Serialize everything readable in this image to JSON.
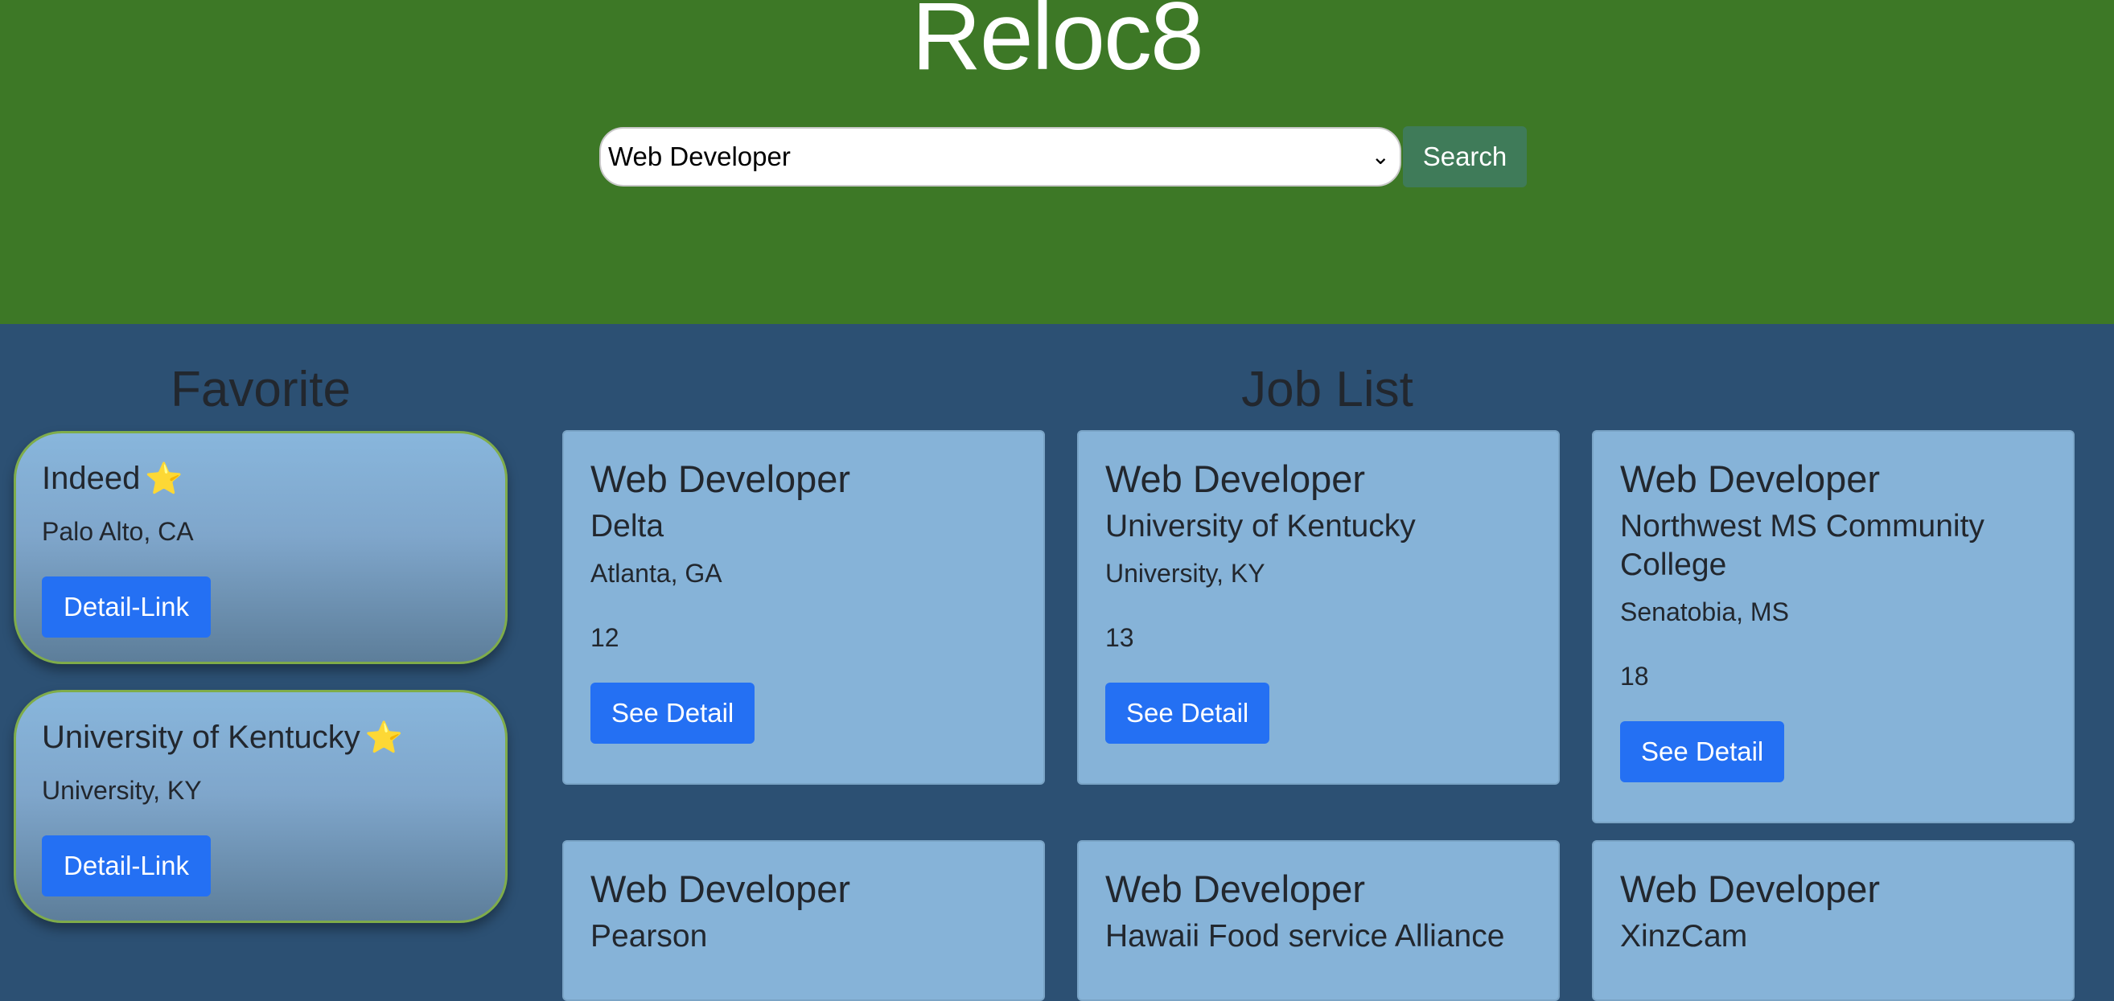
{
  "header": {
    "brand": "Reloc8",
    "search_select_value": "Web Developer",
    "search_button": "Search"
  },
  "favorites": {
    "title": "Favorite",
    "items": [
      {
        "name": "Indeed",
        "location": "Palo Alto, CA",
        "button": "Detail-Link"
      },
      {
        "name": "University of Kentucky",
        "location": "University, KY",
        "button": "Detail-Link"
      }
    ]
  },
  "jobs": {
    "title": "Job List",
    "items": [
      {
        "title": "Web Developer",
        "company": "Delta",
        "location": "Atlanta, GA",
        "count": "12",
        "button": "See Detail"
      },
      {
        "title": "Web Developer",
        "company": "University of Kentucky",
        "location": "University, KY",
        "count": "13",
        "button": "See Detail"
      },
      {
        "title": "Web Developer",
        "company": "Northwest MS Community College",
        "location": "Senatobia, MS",
        "count": "18",
        "button": "See Detail"
      },
      {
        "title": "Web Developer",
        "company": "Pearson"
      },
      {
        "title": "Web Developer",
        "company": "Hawaii Food service Alliance"
      },
      {
        "title": "Web Developer",
        "company": "XinzCam"
      }
    ]
  },
  "colors": {
    "header_bg": "#3d7826",
    "page_bg": "#2c5073",
    "card_bg": "#86b3d8",
    "primary_button": "#2470f3",
    "search_button": "#3f7b59",
    "star": "#f2c31b"
  },
  "icons": {
    "favorite_star": "star-icon",
    "select_caret": "chevron-down-icon"
  }
}
